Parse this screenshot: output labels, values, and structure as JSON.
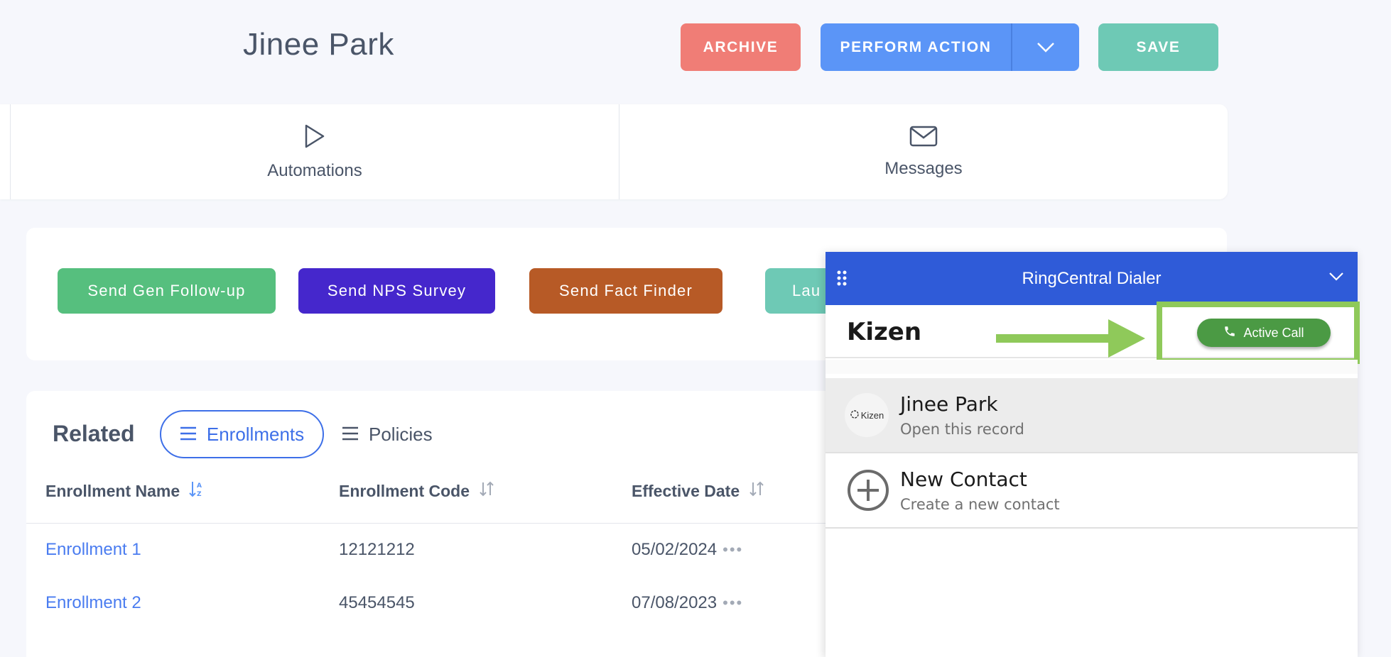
{
  "header": {
    "title": "Jinee Park",
    "archive_label": "ARCHIVE",
    "perform_label": "PERFORM ACTION",
    "save_label": "SAVE",
    "colors": {
      "archive": "#f07d76",
      "perform": "#5b95f7",
      "save": "#6ec9b5"
    }
  },
  "tabs": [
    {
      "label": "Automations",
      "icon": "play-icon"
    },
    {
      "label": "Messages",
      "icon": "envelope-icon"
    }
  ],
  "actions": [
    {
      "label": "Send Gen Follow-up",
      "color": "#56bf7e"
    },
    {
      "label": "Send NPS Survey",
      "color": "#4527cc"
    },
    {
      "label": "Send Fact Finder",
      "color": "#b75a26"
    },
    {
      "label": "Lau",
      "color": "#6ec9b5"
    }
  ],
  "related": {
    "title": "Related",
    "tab_active": "Enrollments",
    "tab_other": "Policies",
    "columns": [
      "Enrollment Name",
      "Enrollment Code",
      "Effective Date"
    ],
    "rows": [
      {
        "name": "Enrollment 1",
        "code": "12121212",
        "date": "05/02/2024"
      },
      {
        "name": "Enrollment 2",
        "code": "45454545",
        "date": "07/08/2023"
      }
    ]
  },
  "dialer": {
    "title": "RingCentral Dialer",
    "brand": "Kizen",
    "active_call_label": "Active Call",
    "items": [
      {
        "title": "Jinee Park",
        "subtitle": "Open this record",
        "avatar_text": "Kizen"
      },
      {
        "title": "New Contact",
        "subtitle": "Create a new contact"
      }
    ],
    "colors": {
      "header": "#2f5bd8",
      "active_call": "#4b9a44",
      "highlight": "#8fc95a"
    }
  }
}
